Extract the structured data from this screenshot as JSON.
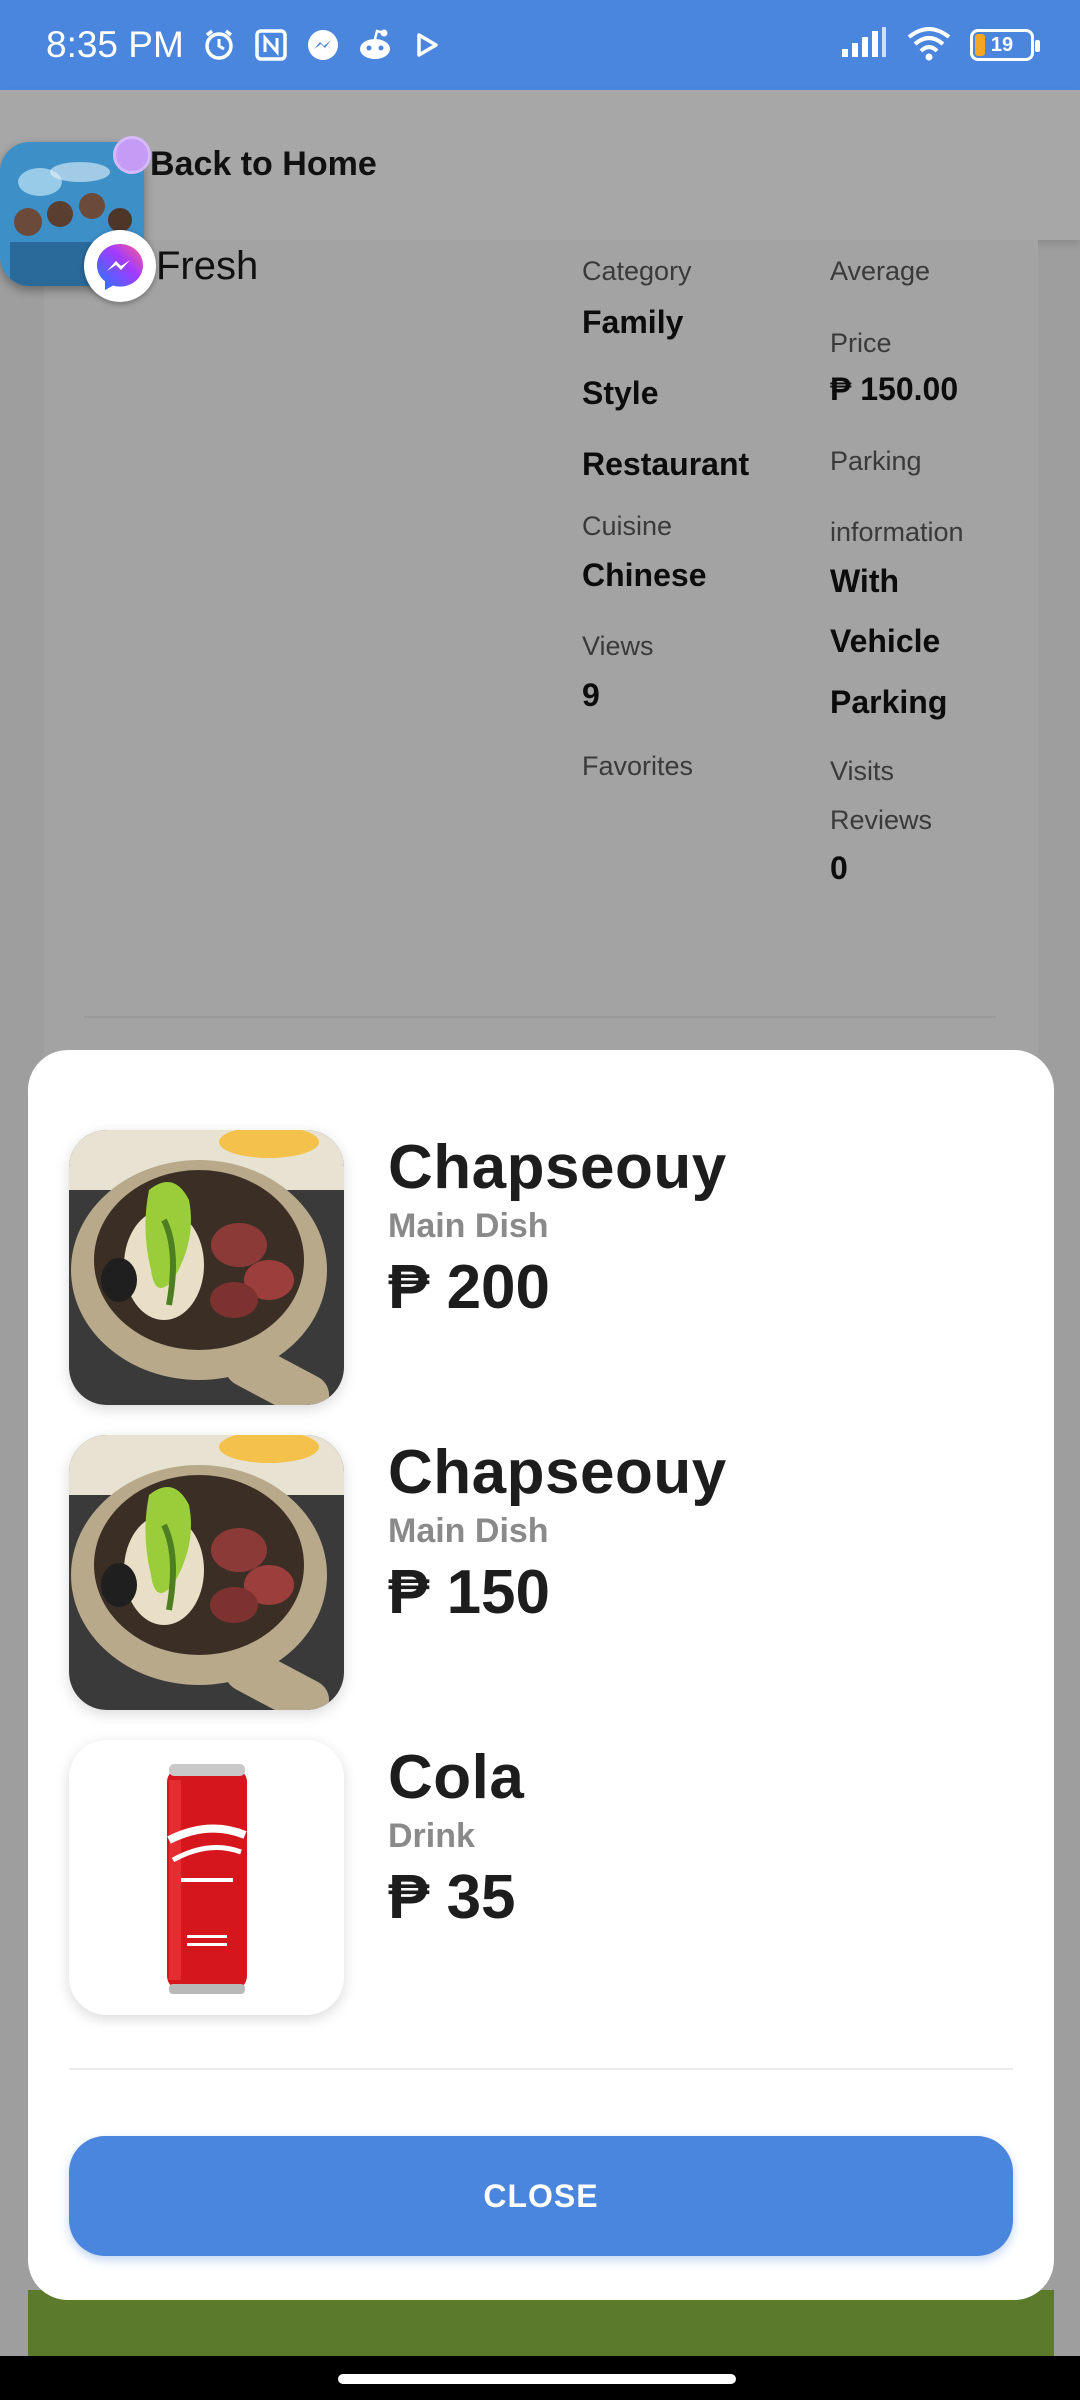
{
  "status_bar": {
    "time": "8:35 PM",
    "icons_left": [
      "alarm-icon",
      "nfc-icon",
      "messenger-icon",
      "reddit-icon",
      "play-icon"
    ],
    "battery_level": "19"
  },
  "header": {
    "back_label": "Back to Home"
  },
  "restaurant": {
    "name": "Fresh",
    "left_column": {
      "category_label": "Category",
      "category_value_lines": [
        "Family",
        "Style",
        "Restaurant"
      ],
      "cuisine_label": "Cuisine",
      "cuisine_value": "Chinese",
      "views_label": "Views",
      "views_value": "9",
      "favorites_label": "Favorites"
    },
    "right_column": {
      "price_label_lines": [
        "Average",
        "Price"
      ],
      "price_value": "₱ 150.00",
      "parking_label_lines": [
        "Parking",
        "information"
      ],
      "parking_value_lines": [
        "With",
        "Vehicle",
        "Parking"
      ],
      "visits_label": "Visits",
      "reviews_label": "Reviews",
      "reviews_value": "0"
    }
  },
  "modal": {
    "items": [
      {
        "name": "Chapseouy",
        "category": "Main Dish",
        "price": "₱ 200",
        "image": "claypot-dish"
      },
      {
        "name": "Chapseouy",
        "category": "Main Dish",
        "price": "₱ 150",
        "image": "claypot-dish"
      },
      {
        "name": "Cola",
        "category": "Drink",
        "price": "₱ 35",
        "image": "cola-can"
      }
    ],
    "close_label": "CLOSE"
  },
  "colors": {
    "accent": "#4a86de",
    "overlay_bg": "#9e9e9e",
    "green_strip": "#5b7a2c"
  }
}
